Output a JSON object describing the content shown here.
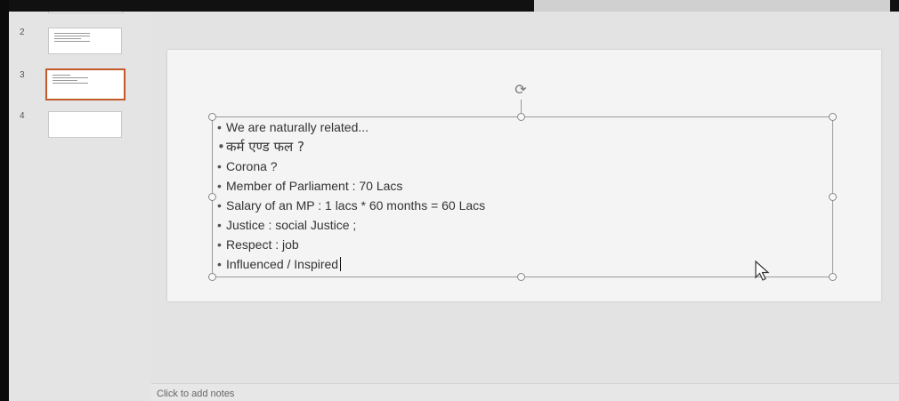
{
  "thumbnails": [
    {
      "number": "2",
      "selected": false
    },
    {
      "number": "3",
      "selected": true
    },
    {
      "number": "4",
      "selected": false
    }
  ],
  "slide": {
    "bullets": [
      "We are naturally related...",
      "कर्म एण्ड फल ?",
      "Corona ?",
      "Member of Parliament : 70 Lacs",
      "Salary of an MP : 1 lacs * 60 months = 60 Lacs",
      "Justice : social Justice ;",
      "Respect : job",
      "Influenced / Inspired"
    ]
  },
  "notes": {
    "placeholder": "Click to add notes"
  },
  "icons": {
    "rotate": "rotate-handle-icon",
    "pointer": "mouse-pointer-icon"
  },
  "colors": {
    "selected_thumb_border": "#c05a2a",
    "pane_bg": "#e3e3e3",
    "slide_bg": "#f4f4f4"
  }
}
